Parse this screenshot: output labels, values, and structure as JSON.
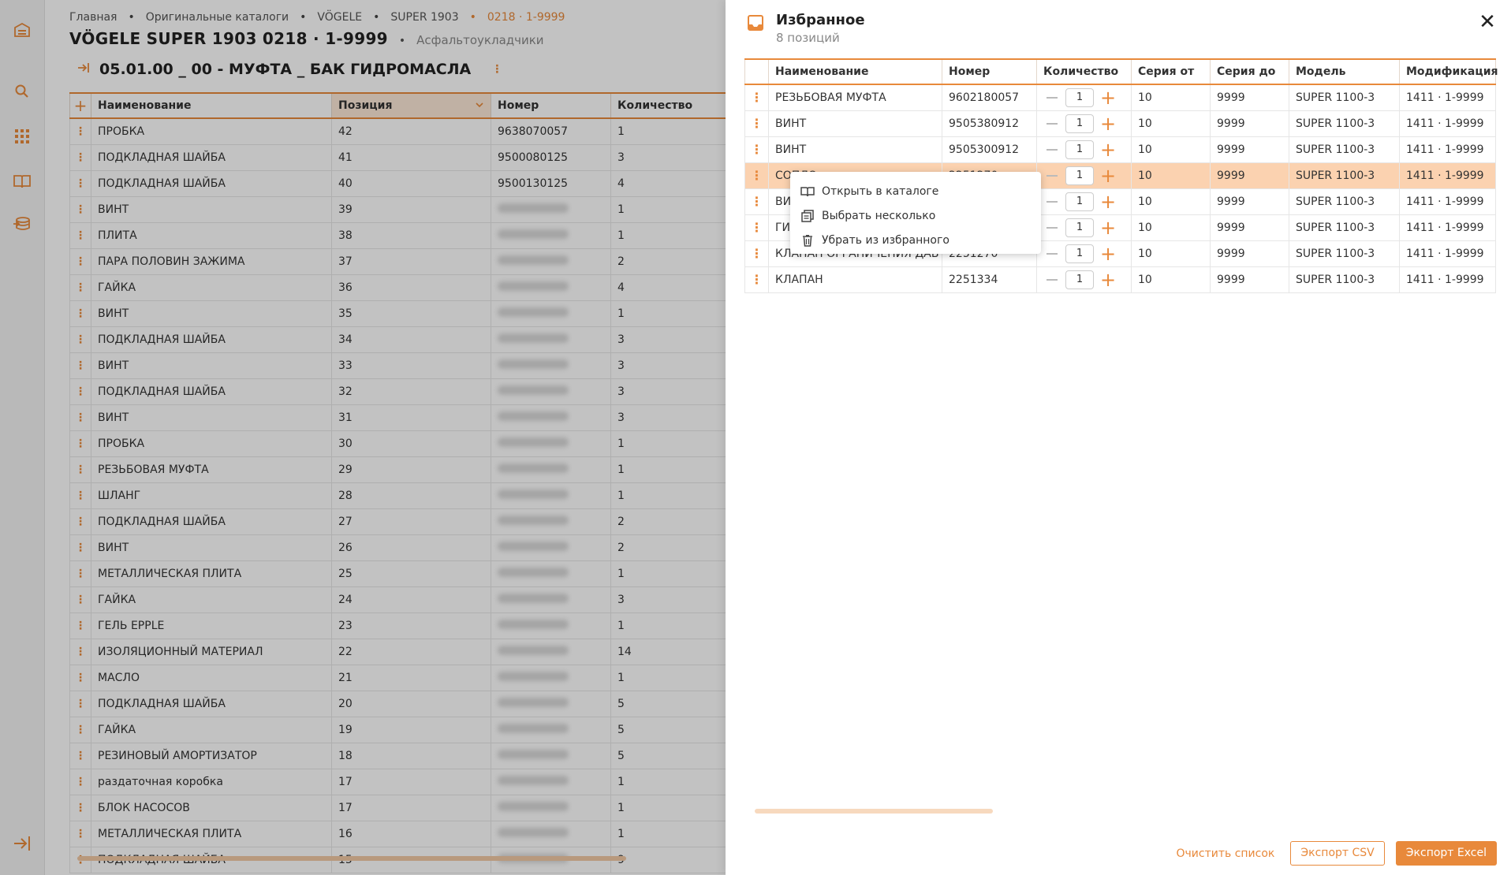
{
  "sidebar": {
    "icons": [
      "warehouse-icon",
      "search-icon",
      "grid-icon",
      "catalog-book-icon",
      "database-icon",
      "collapse-sidebar-icon"
    ]
  },
  "breadcrumb": [
    "Главная",
    "Оригинальные каталоги",
    "VÖGELE",
    "SUPER 1903",
    "0218 · 1-9999"
  ],
  "page": {
    "title": "VÖGELE SUPER 1903 0218 · 1-9999",
    "subtitle": "Асфальтоукладчики",
    "section_title": "05.01.00 _ 00 - МУФТА _ БАК ГИДРОМАСЛА",
    "section_menu": "⋮"
  },
  "parts_table": {
    "headers": {
      "name": "Наименование",
      "position": "Позиция",
      "number": "Номер",
      "quantity": "Количество"
    },
    "add_symbol": "+",
    "menu_symbol": "⋮",
    "rows": [
      {
        "name": "ПРОБКА",
        "position": "42",
        "number": "9638070057",
        "quantity": "1"
      },
      {
        "name": "ПОДКЛАДНАЯ ШАЙБА",
        "position": "41",
        "number": "9500080125",
        "quantity": "3"
      },
      {
        "name": "ПОДКЛАДНАЯ ШАЙБА",
        "position": "40",
        "number": "9500130125",
        "quantity": "4"
      },
      {
        "name": "ВИНТ",
        "position": "39",
        "number": "",
        "quantity": "1"
      },
      {
        "name": "ПЛИТА",
        "position": "38",
        "number": "",
        "quantity": "1"
      },
      {
        "name": "ПАРА ПОЛОВИН ЗАЖИМА",
        "position": "37",
        "number": "",
        "quantity": "2"
      },
      {
        "name": "ГАЙКА",
        "position": "36",
        "number": "",
        "quantity": "4"
      },
      {
        "name": "ВИНТ",
        "position": "35",
        "number": "",
        "quantity": "1"
      },
      {
        "name": "ПОДКЛАДНАЯ ШАЙБА",
        "position": "34",
        "number": "",
        "quantity": "3"
      },
      {
        "name": "ВИНТ",
        "position": "33",
        "number": "",
        "quantity": "3"
      },
      {
        "name": "ПОДКЛАДНАЯ ШАЙБА",
        "position": "32",
        "number": "",
        "quantity": "3"
      },
      {
        "name": "ВИНТ",
        "position": "31",
        "number": "",
        "quantity": "3"
      },
      {
        "name": "ПРОБКА",
        "position": "30",
        "number": "",
        "quantity": "1"
      },
      {
        "name": "РЕЗЬБОВАЯ МУФТА",
        "position": "29",
        "number": "",
        "quantity": "1"
      },
      {
        "name": "ШЛАНГ",
        "position": "28",
        "number": "",
        "quantity": "1"
      },
      {
        "name": "ПОДКЛАДНАЯ ШАЙБА",
        "position": "27",
        "number": "",
        "quantity": "2"
      },
      {
        "name": "ВИНТ",
        "position": "26",
        "number": "",
        "quantity": "2"
      },
      {
        "name": "МЕТАЛЛИЧЕСКАЯ ПЛИТА",
        "position": "25",
        "number": "",
        "quantity": "1"
      },
      {
        "name": "ГАЙКА",
        "position": "24",
        "number": "",
        "quantity": "3"
      },
      {
        "name": "ГЕЛЬ EPPLE",
        "position": "23",
        "number": "",
        "quantity": "1"
      },
      {
        "name": "ИЗОЛЯЦИОННЫЙ МАТЕРИАЛ",
        "position": "22",
        "number": "",
        "quantity": "14"
      },
      {
        "name": "МАСЛО",
        "position": "21",
        "number": "",
        "quantity": "1"
      },
      {
        "name": "ПОДКЛАДНАЯ ШАЙБА",
        "position": "20",
        "number": "",
        "quantity": "5"
      },
      {
        "name": "ГАЙКА",
        "position": "19",
        "number": "",
        "quantity": "5"
      },
      {
        "name": "РЕЗИНОВЫЙ АМОРТИЗАТОР",
        "position": "18",
        "number": "",
        "quantity": "5"
      },
      {
        "name": "раздаточная коробка",
        "position": "17",
        "number": "",
        "quantity": "1"
      },
      {
        "name": "БЛОК НАСОСОВ",
        "position": "17",
        "number": "",
        "quantity": "1"
      },
      {
        "name": "МЕТАЛЛИЧЕСКАЯ ПЛИТА",
        "position": "16",
        "number": "",
        "quantity": "1"
      },
      {
        "name": "ПОДКЛАДНАЯ ШАЙБА",
        "position": "15",
        "number": "",
        "quantity": "9"
      }
    ]
  },
  "favorites": {
    "title": "Избранное",
    "count": "8 позиций",
    "close_symbol": "✕",
    "headers": {
      "name": "Наименование",
      "number": "Номер",
      "quantity": "Количество",
      "series_from": "Серия от",
      "series_to": "Серия до",
      "model": "Модель",
      "modification": "Модификация"
    },
    "menu_symbol": "⋮",
    "minus_symbol": "",
    "plus_symbol": "+",
    "rows": [
      {
        "name": "РЕЗЬБОВАЯ МУФТА",
        "number": "9602180057",
        "quantity": "1",
        "series_from": "10",
        "series_to": "9999",
        "model": "SUPER 1100-3",
        "modification": "1411 · 1-9999"
      },
      {
        "name": "ВИНТ",
        "number": "9505380912",
        "quantity": "1",
        "series_from": "10",
        "series_to": "9999",
        "model": "SUPER 1100-3",
        "modification": "1411 · 1-9999"
      },
      {
        "name": "ВИНТ",
        "number": "9505300912",
        "quantity": "1",
        "series_from": "10",
        "series_to": "9999",
        "model": "SUPER 1100-3",
        "modification": "1411 · 1-9999"
      },
      {
        "name": "СОПЛО",
        "number": "2251270",
        "quantity": "1",
        "series_from": "10",
        "series_to": "9999",
        "model": "SUPER 1100-3",
        "modification": "1411 · 1-9999"
      },
      {
        "name": "ВИ",
        "number": "",
        "quantity": "1",
        "series_from": "10",
        "series_to": "9999",
        "model": "SUPER 1100-3",
        "modification": "1411 · 1-9999"
      },
      {
        "name": "ГИ",
        "number": "",
        "quantity": "1",
        "series_from": "10",
        "series_to": "9999",
        "model": "SUPER 1100-3",
        "modification": "1411 · 1-9999"
      },
      {
        "name": "КЛАПАН ОГРАНИЧЕНИЯ ДАВ",
        "number": "2251270",
        "quantity": "1",
        "series_from": "10",
        "series_to": "9999",
        "model": "SUPER 1100-3",
        "modification": "1411 · 1-9999"
      },
      {
        "name": "КЛАПАН",
        "number": "2251334",
        "quantity": "1",
        "series_from": "10",
        "series_to": "9999",
        "model": "SUPER 1100-3",
        "modification": "1411 · 1-9999"
      }
    ],
    "highlighted_row": 3,
    "context_menu": [
      {
        "label": "Открыть в каталоге",
        "icon": "open-book-icon"
      },
      {
        "label": "Выбрать несколько",
        "icon": "multi-select-icon"
      },
      {
        "label": "Убрать из избранного",
        "icon": "trash-icon"
      }
    ],
    "footer": {
      "clear": "Очистить список",
      "export_csv": "Экспорт CSV",
      "export_excel": "Экспорт Excel"
    }
  },
  "colors": {
    "accent": "#e8893b",
    "highlight_row": "#fbd2b0",
    "overlay": "rgba(0,0,0,0.24)"
  }
}
